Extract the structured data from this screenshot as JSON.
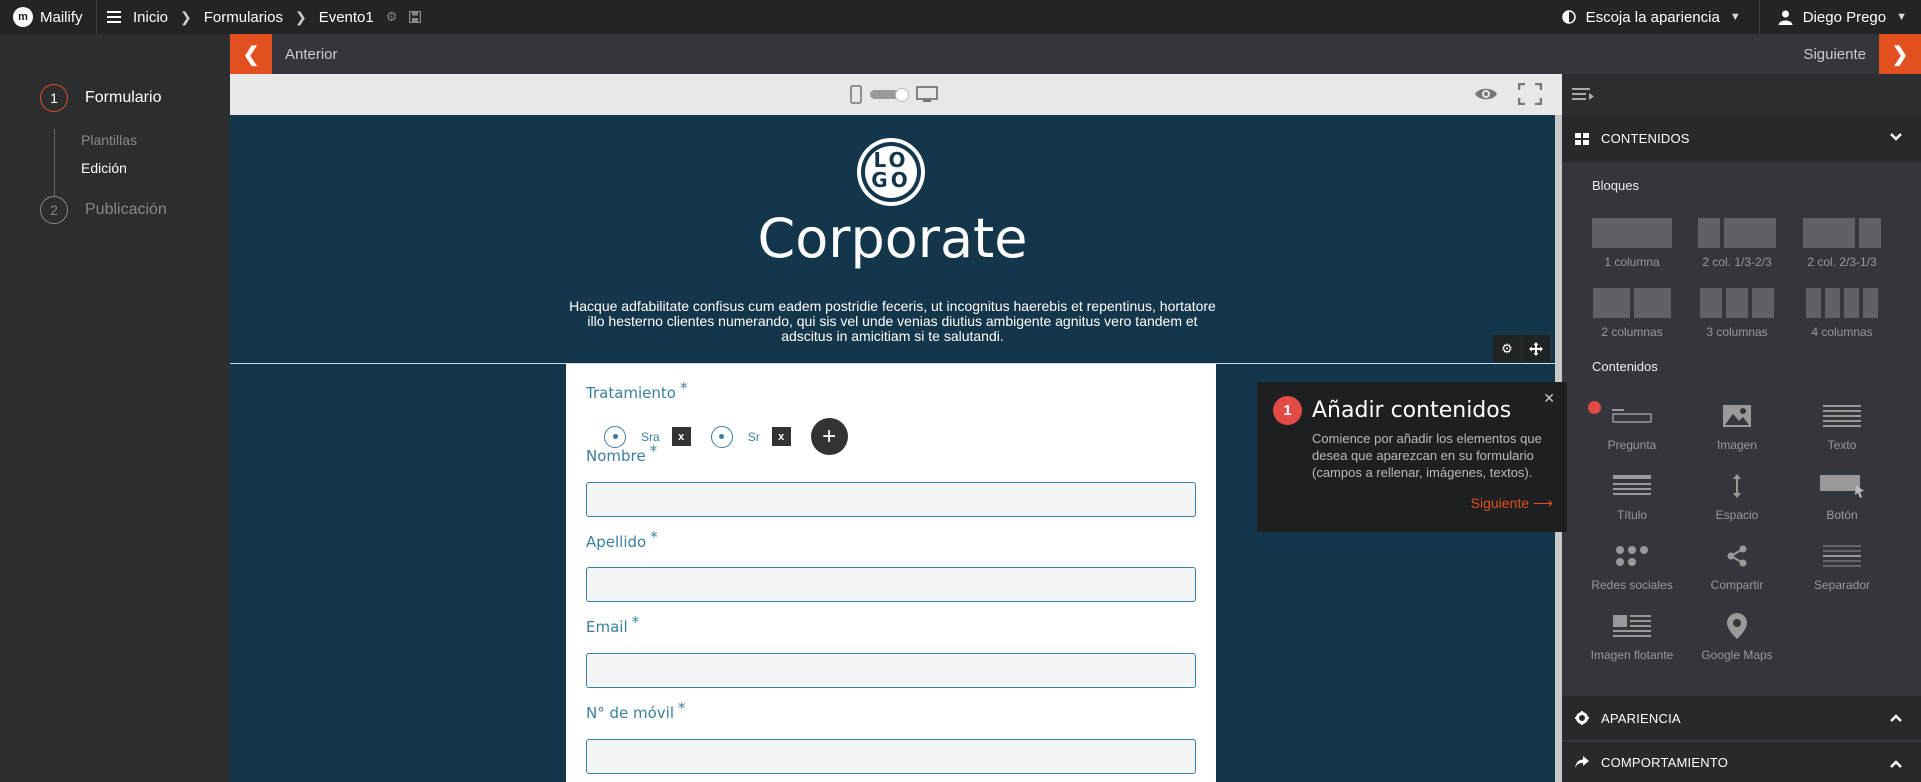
{
  "brand": "Mailify",
  "breadcrumb": [
    "Inicio",
    "Formularios",
    "Evento1"
  ],
  "topbar": {
    "appearance": "Escoja la apariencia",
    "user": "Diego Prego"
  },
  "nav": {
    "prev": "Anterior",
    "next": "Siguiente"
  },
  "steps": [
    {
      "num": "1",
      "label": "Formulario",
      "substeps": [
        "Plantillas",
        "Edición"
      ]
    },
    {
      "num": "2",
      "label": "Publicación"
    }
  ],
  "canvas": {
    "logo_line1": "LO",
    "logo_line2": "GO",
    "title": "Corporate",
    "intro": "Hacque adfabilitate confisus cum eadem postridie feceris, ut incognitus haerebis et repentinus, hortatore illo hesterno clientes numerando, qui sis vel unde venias diutius ambigente agnitus vero tandem et adscitus in amicitiam si te salutandi."
  },
  "form": {
    "treatment_label": "Tratamiento",
    "options": [
      "Sra",
      "Sr"
    ],
    "x_label": "x",
    "fields": [
      "Nombre",
      "Apellido",
      "Email",
      "N° de móvil"
    ],
    "required_mark": "*"
  },
  "tour": {
    "num": "1",
    "title": "Añadir contenidos",
    "text": "Comience por añadir los elementos que desea que aparezcan en su formulario (campos a rellenar, imágenes, textos).",
    "next": "Siguiente"
  },
  "panel": {
    "contents_head": "CONTENIDOS",
    "blocks_title": "Bloques",
    "blocks": [
      "1 columna",
      "2 col. 1/3-2/3",
      "2 col. 2/3-1/3",
      "2 columnas",
      "3 columnas",
      "4 columnas"
    ],
    "contents_title": "Contenidos",
    "components": [
      "Pregunta",
      "Imagen",
      "Texto",
      "Título",
      "Espacio",
      "Botón",
      "Redes sociales",
      "Compartir",
      "Separador",
      "Imagen flotante",
      "Google Maps"
    ],
    "appearance_head": "APARIENCIA",
    "behavior_head": "COMPORTAMIENTO"
  },
  "colors": {
    "accent": "#e1501e",
    "canvas_bg": "#14364a",
    "field_blue": "#3b7fa0",
    "tour_red": "#e14b43"
  }
}
